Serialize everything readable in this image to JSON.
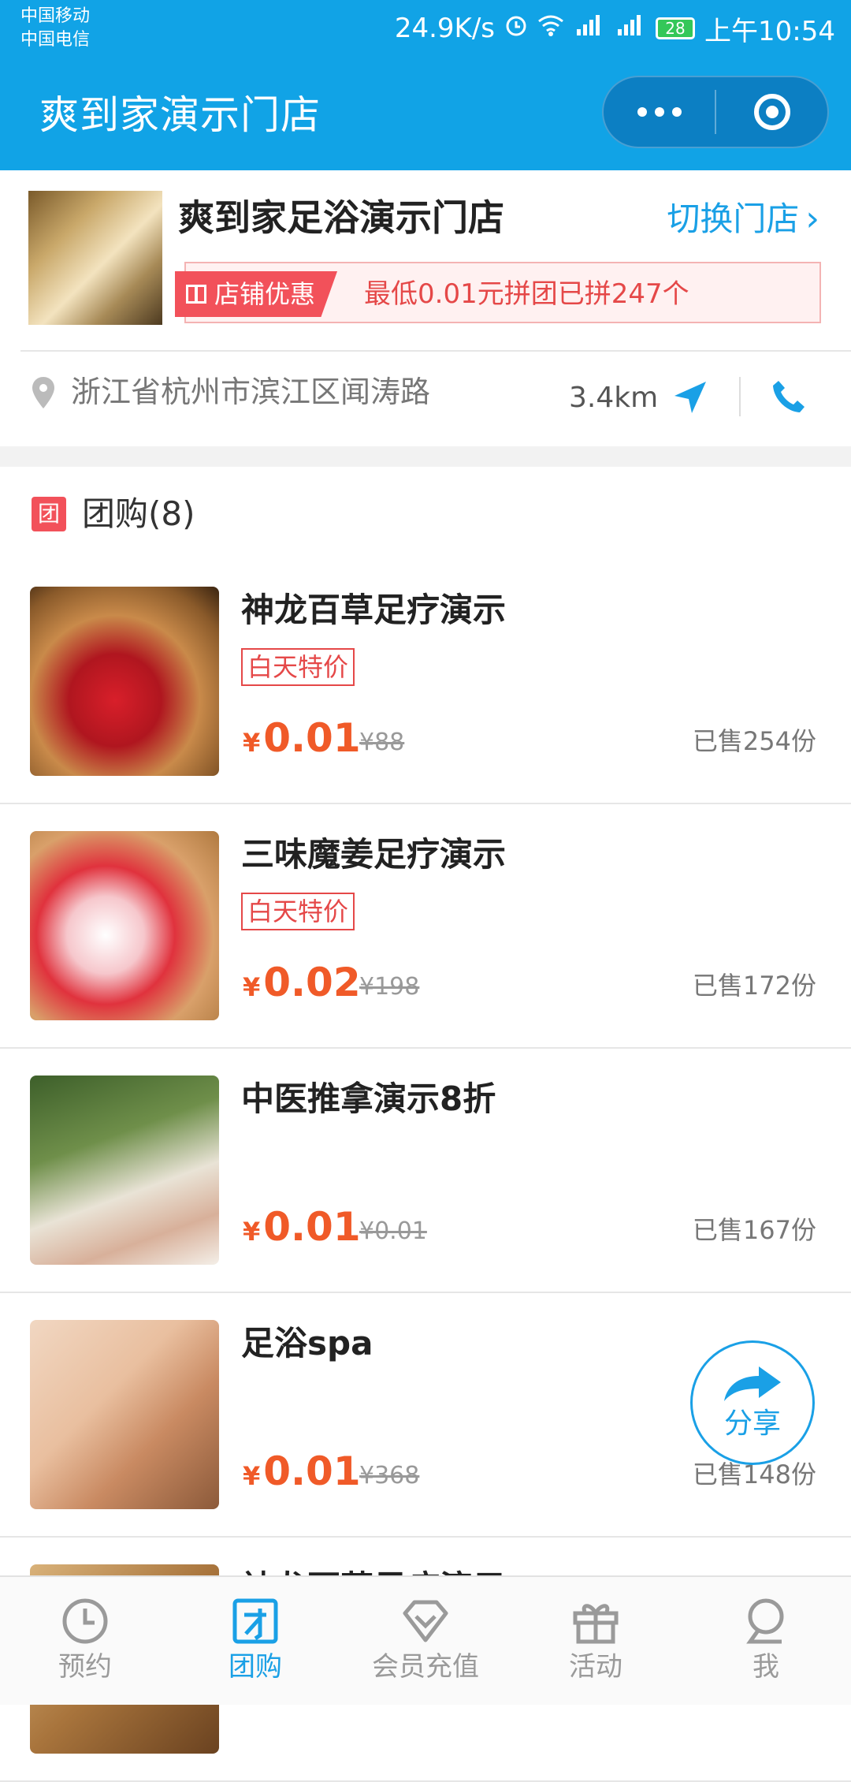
{
  "status_bar": {
    "carrier_1": "中国移动",
    "carrier_2": "中国电信",
    "net_speed": "24.9K/s",
    "battery": "28",
    "time": "上午10:54"
  },
  "nav": {
    "title": "爽到家演示门店"
  },
  "store": {
    "name": "爽到家足浴演示门店",
    "switch_label": "切换门店",
    "promo_tag": "店铺优惠",
    "promo_text": "最低0.01元拼团已拼247个",
    "address": "浙江省杭州市滨江区闻涛路",
    "distance": "3.4km"
  },
  "section": {
    "badge": "团",
    "title": "团购(8)"
  },
  "deals": [
    {
      "title": "神龙百草足疗演示",
      "tag": "白天特价",
      "yen": "¥",
      "price": "0.01",
      "orig": "¥88",
      "sold": "已售254份"
    },
    {
      "title": "三味魔姜足疗演示",
      "tag": "白天特价",
      "yen": "¥",
      "price": "0.02",
      "orig": "¥198",
      "sold": "已售172份"
    },
    {
      "title": "中医推拿演示8折",
      "tag": "",
      "yen": "¥",
      "price": "0.01",
      "orig": "¥0.01",
      "sold": "已售167份"
    },
    {
      "title": "足浴spa",
      "tag": "",
      "yen": "¥",
      "price": "0.01",
      "orig": "¥368",
      "sold": "已售148份"
    },
    {
      "title": "神龙百草足疗演示",
      "tag": "",
      "yen": "",
      "price": "",
      "orig": "",
      "sold": ""
    }
  ],
  "share": {
    "label": "分享"
  },
  "tabs": [
    {
      "label": "预约",
      "icon": "clock-icon"
    },
    {
      "label": "团购",
      "icon": "group-buy-icon"
    },
    {
      "label": "会员充值",
      "icon": "diamond-icon"
    },
    {
      "label": "活动",
      "icon": "gift-icon"
    },
    {
      "label": "我",
      "icon": "user-icon"
    }
  ],
  "colors": {
    "brand_blue": "#11a3e6",
    "price_orange": "#f05a28",
    "promo_red": "#f2515a"
  }
}
